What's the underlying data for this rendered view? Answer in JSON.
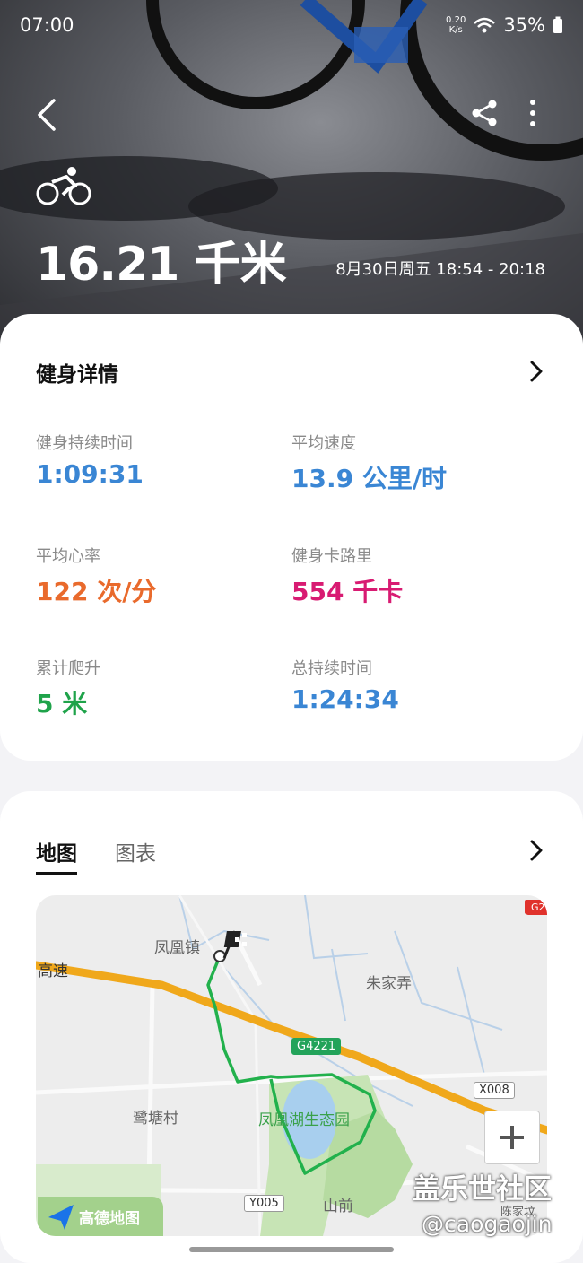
{
  "status_bar": {
    "time": "07:00",
    "net_speed_value": "0.20",
    "net_speed_unit": "K/s",
    "battery": "35%"
  },
  "header": {
    "activity_icon": "bicycle-icon",
    "distance": "16.21 千米",
    "time_range": "8月30日周五 18:54 - 20:18"
  },
  "details": {
    "title": "健身详情",
    "metrics": [
      {
        "label": "健身持续时间",
        "value": "1:09:31",
        "color": "#3a86d4"
      },
      {
        "label": "平均速度",
        "value": "13.9 公里/时",
        "color": "#3a86d4"
      },
      {
        "label": "平均心率",
        "value": "122 次/分",
        "color": "#e96a2c"
      },
      {
        "label": "健身卡路里",
        "value": "554 千卡",
        "color": "#d81b72"
      },
      {
        "label": "累计爬升",
        "value": "5 米",
        "color": "#1fa34a"
      },
      {
        "label": "总持续时间",
        "value": "1:24:34",
        "color": "#3a86d4"
      }
    ]
  },
  "map_section": {
    "tabs": [
      "地图",
      "图表"
    ],
    "active_tab": "地图",
    "map_labels": {
      "town": "凤凰镇",
      "highway": "高速",
      "village1": "朱家弄",
      "village2": "鹭塘村",
      "park": "凤凰湖生态园",
      "place": "山前",
      "partial": "陈家坟"
    },
    "road_tags": [
      "G4221",
      "X008",
      "Y005",
      "G2"
    ],
    "provider": "高德地图",
    "route_color": "#22b14c"
  },
  "watermark": {
    "line1": "盖乐世社区",
    "line2": "@caogaojin"
  }
}
